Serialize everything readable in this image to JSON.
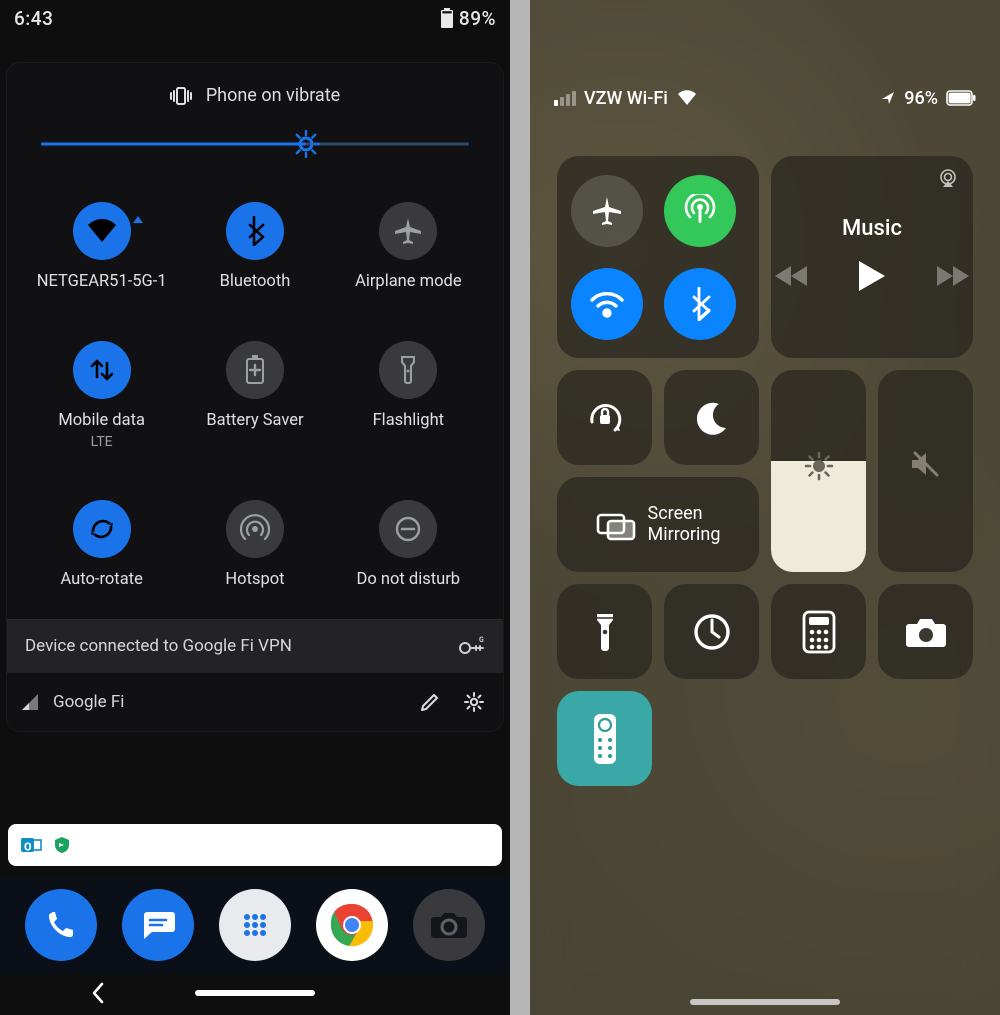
{
  "android": {
    "status": {
      "time": "6:43",
      "battery_pct": "89%"
    },
    "header_text": "Phone on vibrate",
    "brightness_pct": 62,
    "tiles": [
      {
        "name": "wifi",
        "label": "NETGEAR51-5G-1",
        "sub": "",
        "active": true,
        "expandable": true
      },
      {
        "name": "bluetooth",
        "label": "Bluetooth",
        "sub": "",
        "active": true,
        "expandable": false
      },
      {
        "name": "airplane",
        "label": "Airplane mode",
        "sub": "",
        "active": false,
        "expandable": false
      },
      {
        "name": "mobiledata",
        "label": "Mobile data",
        "sub": "LTE",
        "active": true,
        "expandable": false
      },
      {
        "name": "batterysaver",
        "label": "Battery Saver",
        "sub": "",
        "active": false,
        "expandable": false
      },
      {
        "name": "flashlight",
        "label": "Flashlight",
        "sub": "",
        "active": false,
        "expandable": false
      },
      {
        "name": "autorotate",
        "label": "Auto-rotate",
        "sub": "",
        "active": true,
        "expandable": false
      },
      {
        "name": "hotspot",
        "label": "Hotspot",
        "sub": "",
        "active": false,
        "expandable": false
      },
      {
        "name": "dnd",
        "label": "Do not disturb",
        "sub": "",
        "active": false,
        "expandable": false
      }
    ],
    "vpn_notice": "Device connected to Google Fi VPN",
    "carrier": "Google Fi",
    "notification_apps": [
      "outlook",
      "google-play-protect"
    ],
    "dock": [
      "phone",
      "messages",
      "apps",
      "chrome",
      "camera"
    ]
  },
  "ios": {
    "status": {
      "carrier": "VZW Wi-Fi",
      "battery_pct": "96%",
      "location_arrow": true
    },
    "connectivity": {
      "airplane": {
        "active": false
      },
      "cellular": {
        "active": true,
        "color": "green"
      },
      "wifi": {
        "active": true,
        "color": "blue"
      },
      "bluetooth": {
        "active": true,
        "color": "blue"
      }
    },
    "media": {
      "title": "Music"
    },
    "screen_mirroring_label": "Screen\nMirroring",
    "brightness_pct": 55,
    "volume_pct": 0,
    "tiles": [
      "orientation-lock",
      "dnd",
      "screen-mirroring",
      "flashlight",
      "timer",
      "calculator",
      "camera",
      "apple-tv-remote"
    ]
  }
}
